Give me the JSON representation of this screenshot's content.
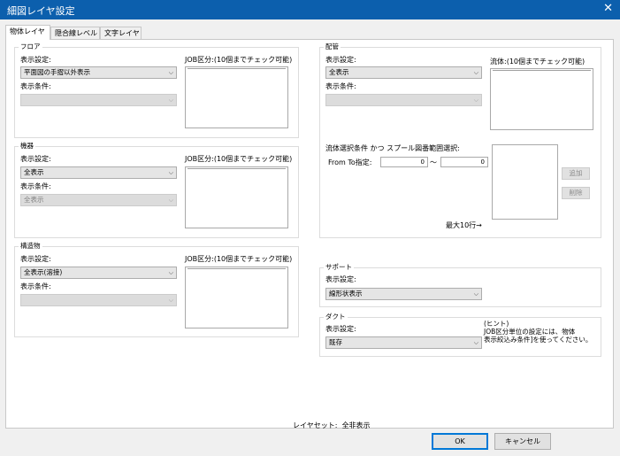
{
  "window": {
    "title": "細図レイヤ設定",
    "close_label": "✕"
  },
  "tabs": [
    {
      "label": "物体レイヤ",
      "active": true
    },
    {
      "label": "隠合線レベル",
      "active": false
    },
    {
      "label": "文字レイヤ",
      "active": false
    }
  ],
  "floor": {
    "title": "フロア",
    "display_setting_label": "表示設定:",
    "display_setting_value": "平面図の手摺以外表示",
    "display_condition_label": "表示条件:",
    "display_condition_value": "",
    "job_label": "JOB区分:(10個までチェック可能)"
  },
  "equipment": {
    "title": "機器",
    "display_setting_label": "表示設定:",
    "display_setting_value": "全表示",
    "display_condition_label": "表示条件:",
    "display_condition_value": "全表示",
    "job_label": "JOB区分:(10個までチェック可能)"
  },
  "structure": {
    "title": "構造物",
    "display_setting_label": "表示設定:",
    "display_setting_value": "全表示(溶接)",
    "display_condition_label": "表示条件:",
    "display_condition_value": "",
    "job_label": "JOB区分:(10個までチェック可能)"
  },
  "piping": {
    "title": "配管",
    "display_setting_label": "表示設定:",
    "display_setting_value": "全表示",
    "display_condition_label": "表示条件:",
    "display_condition_value": "",
    "flow_label": "流体:(10個までチェック可能)",
    "selection_condition_label": "流体選択条件 かつ スプール図番範囲選択:",
    "from_to_label": "From To指定:",
    "from_value": "0",
    "tilde": "〜",
    "to_value": "0",
    "add_label": "追加",
    "delete_label": "削除",
    "max_rows_label": "最大10行→"
  },
  "support": {
    "title": "サポート",
    "display_setting_label": "表示設定:",
    "display_setting_value": "線形状表示"
  },
  "duct": {
    "title": "ダクト",
    "display_setting_label": "表示設定:",
    "display_setting_value": "既存",
    "hint_line1": "(ヒント)",
    "hint_line2": "JOB区分単位の設定には、物体",
    "hint_line3": "表示絞込み条件]を使ってください。"
  },
  "layer_set": {
    "label": "レイヤセット:",
    "value": "全非表示"
  },
  "buttons": {
    "ok": "OK",
    "cancel": "キャンセル"
  },
  "icons": {
    "dropdown": "chevron-down-icon",
    "close": "close-icon"
  }
}
